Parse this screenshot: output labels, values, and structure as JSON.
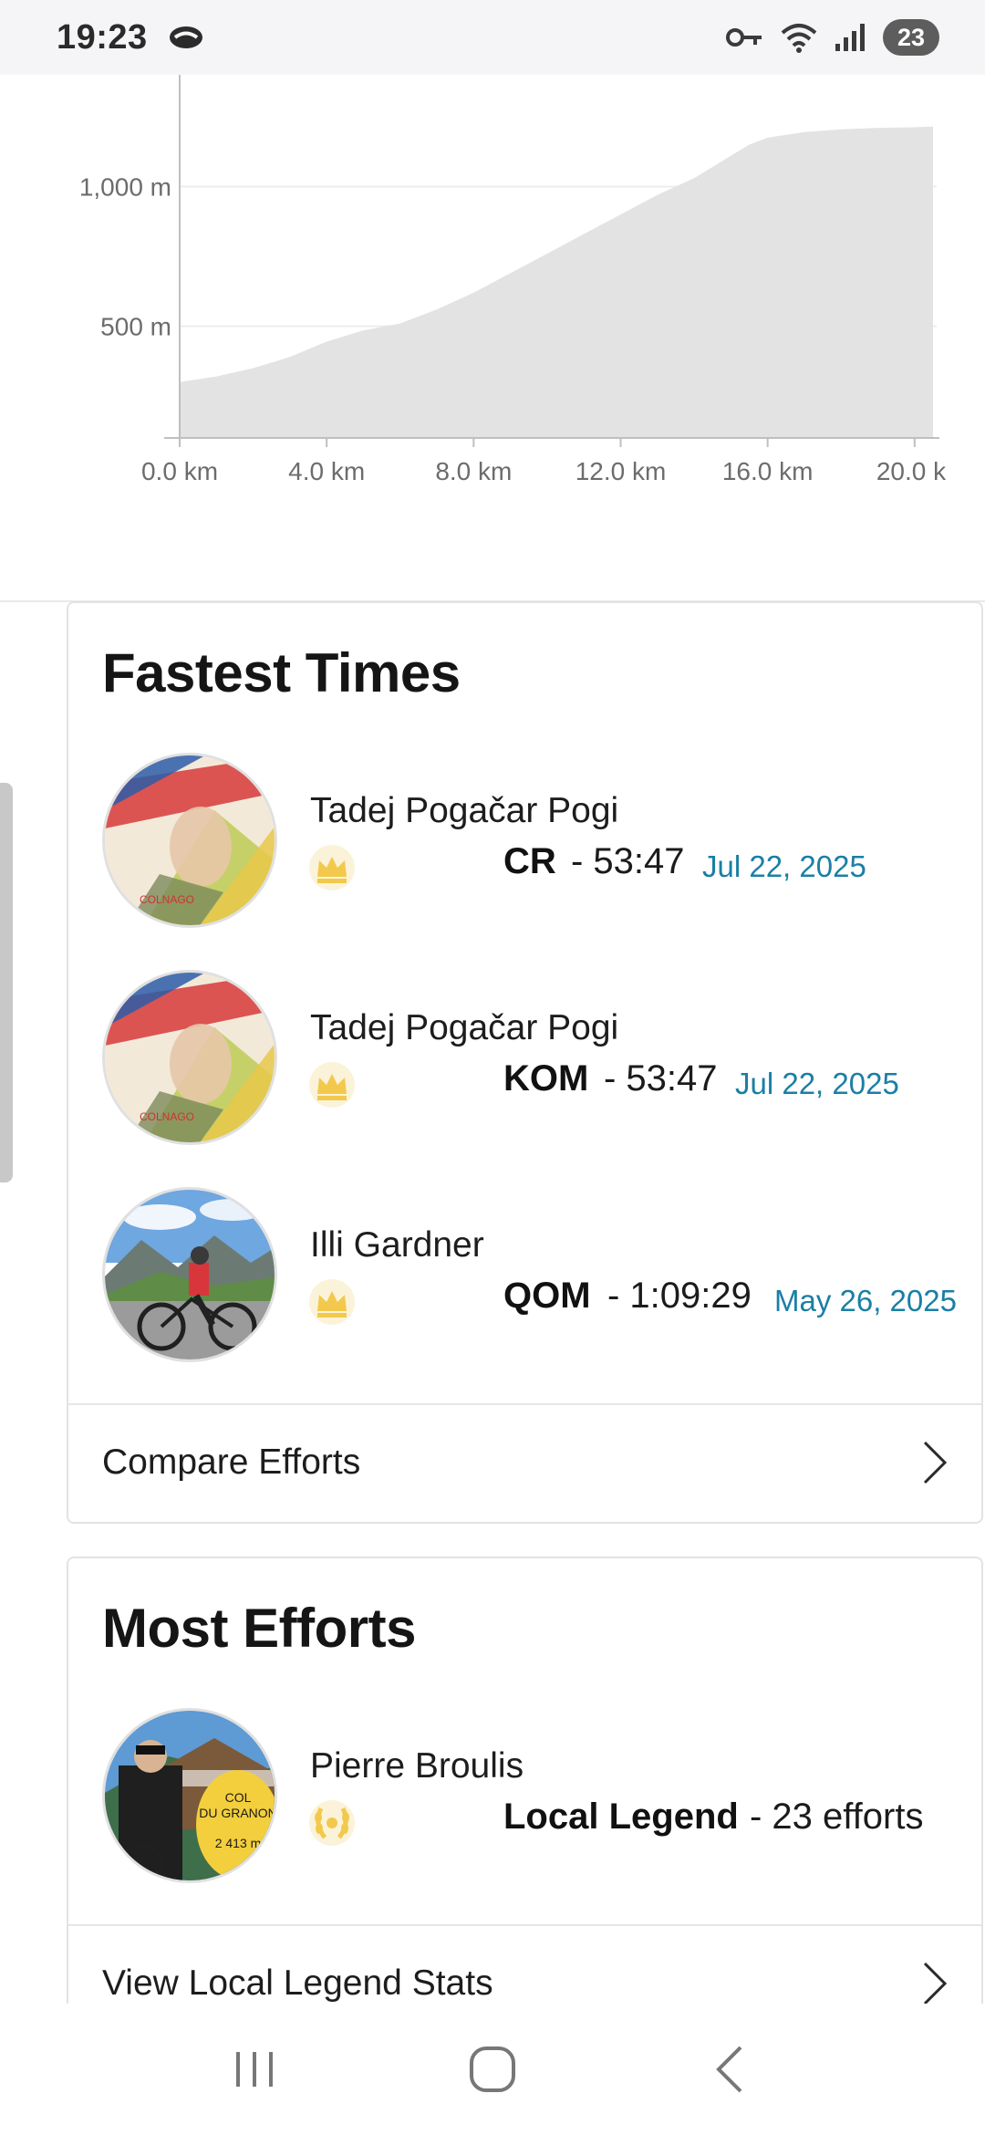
{
  "status_bar": {
    "time": "19:23",
    "battery": "23",
    "icons": [
      "messenger-icon",
      "vpn-key-icon",
      "wifi-icon",
      "signal-icon",
      "battery-icon"
    ]
  },
  "elevation_chart": {
    "chart_data": {
      "type": "area",
      "title": "",
      "xlabel": "",
      "ylabel": "",
      "x_tick_labels": [
        "0.0 km",
        "4.0 km",
        "8.0 km",
        "12.0 km",
        "16.0 km",
        "20.0 k"
      ],
      "y_tick_labels": [
        "500 m",
        "1,000 m"
      ],
      "x": [
        0,
        1,
        2,
        3,
        4,
        4.5,
        5,
        6,
        7,
        8,
        9,
        10,
        11,
        12,
        13,
        14,
        14.5,
        15,
        15.5,
        16,
        17,
        18,
        19,
        20,
        20.5
      ],
      "y": [
        300,
        320,
        350,
        390,
        445,
        465,
        485,
        510,
        560,
        620,
        690,
        760,
        830,
        900,
        970,
        1030,
        1070,
        1110,
        1150,
        1175,
        1195,
        1205,
        1210,
        1212,
        1215
      ],
      "xlim": [
        0,
        20.6
      ],
      "ylim": [
        100,
        1400
      ],
      "grid": true,
      "color": "#e3e3e3"
    }
  },
  "fastest_times": {
    "title": "Fastest Times",
    "entries": [
      {
        "name": "Tadej Pogačar Pogi",
        "award": "CR",
        "value": "- 53:47",
        "date": "Jul 22, 2025",
        "icon": "crown-icon"
      },
      {
        "name": "Tadej Pogačar Pogi",
        "award": "KOM",
        "value": "- 53:47",
        "date": "Jul 22, 2025",
        "icon": "crown-icon"
      },
      {
        "name": "Illi Gardner",
        "award": "QOM",
        "value": "- 1:09:29",
        "date": "May 26, 2025",
        "icon": "crown-icon"
      }
    ],
    "compare_label": "Compare Efforts"
  },
  "most_efforts": {
    "title": "Most Efforts",
    "entries": [
      {
        "name": "Pierre Broulis",
        "award": "Local Legend",
        "value": "- 23 efforts",
        "icon": "laurel-icon"
      }
    ],
    "avatar_sign": {
      "line1": "COL",
      "line2": "DU GRANON",
      "line3": "2 413 m"
    },
    "view_label": "View Local Legend Stats"
  },
  "colors": {
    "date": "#1a7fa5",
    "crown": "#f2c94c",
    "chart_fill": "#e3e3e3"
  },
  "nav_bar": {
    "icons": [
      "recents-icon",
      "home-icon",
      "back-icon"
    ]
  }
}
